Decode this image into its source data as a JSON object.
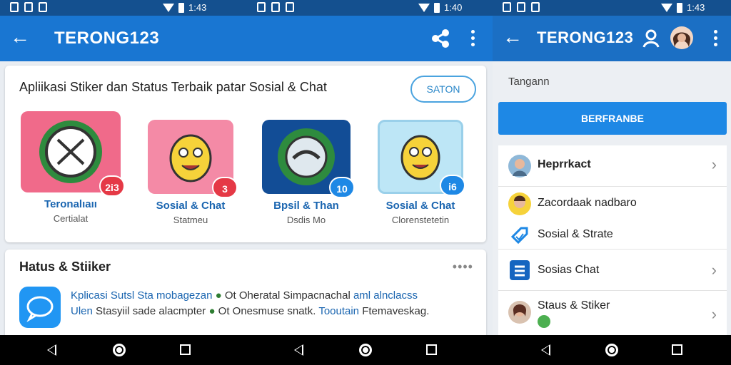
{
  "status_bar": {
    "time_1": "1:43",
    "time_2": "1:40",
    "time_3": "1:43"
  },
  "app_bar_left": {
    "title": "TERONG123",
    "back_icon": "arrow-left-icon",
    "share_icon": "share-icon"
  },
  "app_bar_right": {
    "title": "TERONG123",
    "back_icon": "arrow-left-icon",
    "profile_icon": "person-icon"
  },
  "promo": {
    "title": "Apliikasi Stiker dan Status Terbaik patar Sosial & Chat",
    "button": "SATON",
    "tiles": [
      {
        "name": "Teronalıaıı",
        "sub": "Certialat",
        "badge": "2i3",
        "badge_color": "#e53946"
      },
      {
        "name": "Sosial & Chat",
        "sub": "Statmeu",
        "badge": "3",
        "badge_color": "#e53946"
      },
      {
        "name": "Bpsil & Than",
        "sub": "Dsdis Mo",
        "badge": "10",
        "badge_color": "#1e88e5"
      },
      {
        "name": "Sosial & Chat",
        "sub": "Clorenstetetin",
        "badge": "i6",
        "badge_color": "#1e88e5"
      }
    ]
  },
  "section": {
    "title": "Hatus & Stiiker",
    "more": "••••",
    "line1_a": "Kplicasi Sutsl Sta mobagezan",
    "line1_b": "Ot Oheratal Simpacnachal",
    "line1_c": "aml alnclacss",
    "line2_a": "Ulen",
    "line2_b": "Stasyiil sade alacmpter",
    "line2_c": "Ot Onesmuse snatk.",
    "line2_d": "Tooutain",
    "line2_e": "Ftemaveskag."
  },
  "right_panel": {
    "label": "Tangann",
    "button": "BERFRANBE",
    "items": [
      {
        "label": "Heprrkact",
        "chevron": true
      },
      {
        "label": "Zacordaak nadbaro",
        "chevron": false
      },
      {
        "label": "Sosial & Strate",
        "chevron": false
      },
      {
        "label": "Sosias Chat",
        "chevron": true
      },
      {
        "label": "Staus & Stiker",
        "chevron": true
      }
    ]
  },
  "colors": {
    "app_bar": "#1976d2",
    "status_bar": "#14508f",
    "accent_blue": "#1e88e5",
    "badge_red": "#e53946",
    "online_green": "#4caf50"
  }
}
